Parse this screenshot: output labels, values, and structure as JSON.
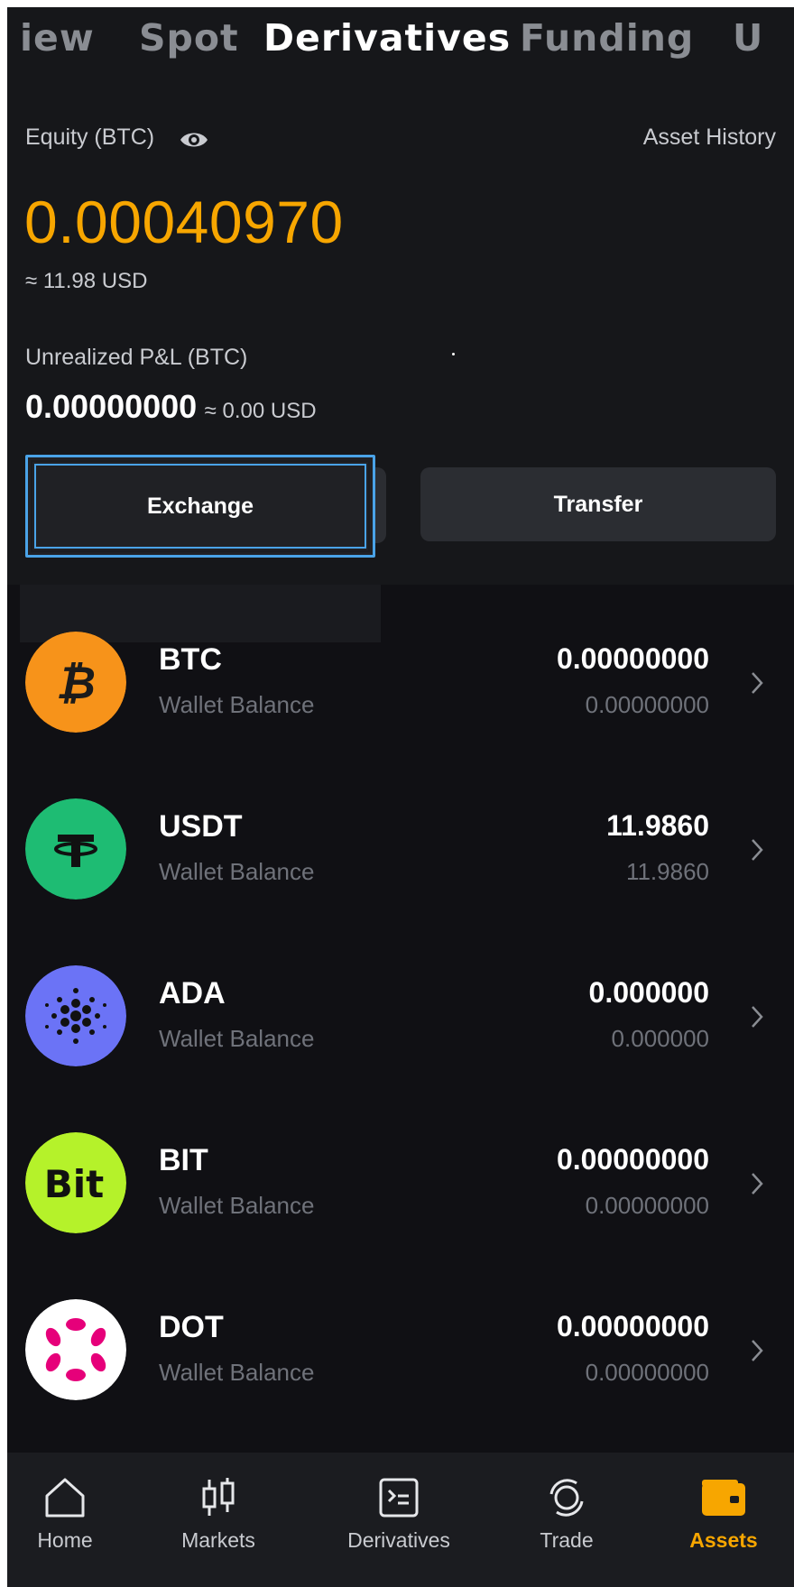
{
  "tabs": [
    "iew",
    "Spot",
    "Derivatives",
    "Funding",
    "U"
  ],
  "active_tab": "Derivatives",
  "equity": {
    "label": "Equity (BTC)",
    "value": "0.00040970",
    "usd": "≈ 11.98 USD",
    "history_link": "Asset History"
  },
  "pnl": {
    "label": "Unrealized P&L (BTC)",
    "value": "0.00000000",
    "usd": "≈ 0.00 USD"
  },
  "actions": {
    "exchange": "Exchange",
    "transfer": "Transfer"
  },
  "assets": [
    {
      "name": "BTC",
      "sub": "Wallet Balance",
      "balance": "0.00000000",
      "balance2": "0.00000000",
      "icon": "btc-icon",
      "color": "#f7931a"
    },
    {
      "name": "USDT",
      "sub": "Wallet Balance",
      "balance": "11.9860",
      "balance2": "11.9860",
      "icon": "usdt-icon",
      "color": "#1ebc73"
    },
    {
      "name": "ADA",
      "sub": "Wallet Balance",
      "balance": "0.000000",
      "balance2": "0.000000",
      "icon": "ada-icon",
      "color": "#6b73f6"
    },
    {
      "name": "BIT",
      "sub": "Wallet Balance",
      "balance": "0.00000000",
      "balance2": "0.00000000",
      "icon": "bit-icon",
      "color": "#b5f22a"
    },
    {
      "name": "DOT",
      "sub": "Wallet Balance",
      "balance": "0.00000000",
      "balance2": "0.00000000",
      "icon": "dot-icon",
      "color": "#e6007a"
    }
  ],
  "nav": [
    {
      "label": "Home",
      "icon": "home-icon"
    },
    {
      "label": "Markets",
      "icon": "candlestick-icon"
    },
    {
      "label": "Derivatives",
      "icon": "terminal-icon"
    },
    {
      "label": "Trade",
      "icon": "swap-cycle-icon"
    },
    {
      "label": "Assets",
      "icon": "wallet-icon"
    }
  ],
  "colors": {
    "accent": "#f7a600",
    "background": "#16171a"
  }
}
